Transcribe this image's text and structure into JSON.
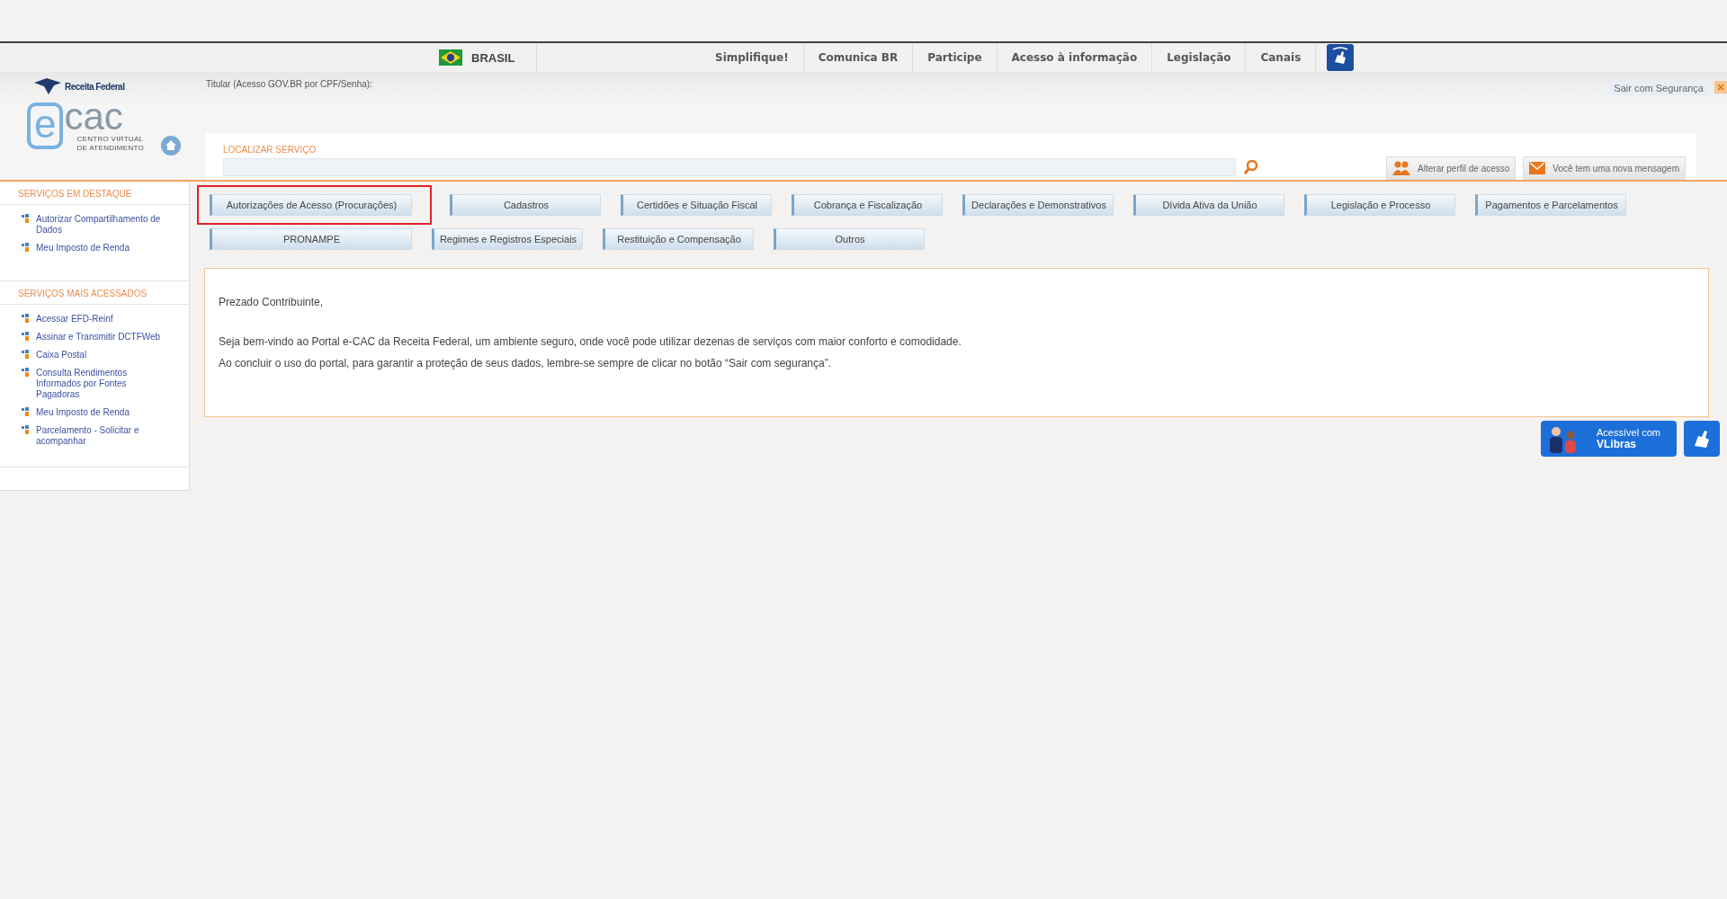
{
  "gov_bar": {
    "country": "BRASIL",
    "links": [
      "Simplifique!",
      "Comunica BR",
      "Participe",
      "Acesso à informação",
      "Legislação",
      "Canais"
    ]
  },
  "header": {
    "agency": "Receita Federal",
    "logo_letter": "e",
    "logo_name": "cac",
    "logo_subtitle": [
      "CENTRO VIRTUAL",
      "DE ATENDIMENTO"
    ],
    "user_label": "Titular (Acesso GOV.BR por CPF/Senha):",
    "logout": "Sair com Segurança"
  },
  "search": {
    "label": "LOCALIZAR SERVIÇO"
  },
  "actions": [
    {
      "kind": "profile",
      "label": "Alterar perfil de acesso"
    },
    {
      "kind": "message",
      "label": "Você tem uma nova mensagem"
    }
  ],
  "sidebar": [
    {
      "title": "SERVIÇOS EM DESTAQUE",
      "items": [
        "Autorizar Compartilhamento de Dados",
        "Meu Imposto de Renda"
      ]
    },
    {
      "title": "SERVIÇOS MAIS ACESSADOS",
      "items": [
        "Acessar EFD-Reinf",
        "Assinar e Transmitir DCTFWeb",
        "Caixa Postal",
        "Consulta Rendimentos Informados por Fontes Pagadoras",
        "Meu Imposto de Renda",
        "Parcelamento - Solicitar e acompanhar"
      ]
    }
  ],
  "categories": [
    [
      {
        "label": "Autorizações de Acesso (Procurações)",
        "highlighted": true
      },
      {
        "label": "Cadastros",
        "highlighted": false
      },
      {
        "label": "Certidões e Situação Fiscal",
        "highlighted": false
      },
      {
        "label": "Cobrança e Fiscalização",
        "highlighted": false
      },
      {
        "label": "Declarações e Demonstrativos",
        "highlighted": false
      },
      {
        "label": "Dívida Ativa da União",
        "highlighted": false
      },
      {
        "label": "Legislação e Processo",
        "highlighted": false
      },
      {
        "label": "Pagamentos e Parcelamentos",
        "highlighted": false
      }
    ],
    [
      {
        "label": "PRONAMPE",
        "highlighted": false
      },
      {
        "label": "Regimes e Registros Especiais",
        "highlighted": false
      },
      {
        "label": "Restituição e Compensação",
        "highlighted": false
      },
      {
        "label": "Outros",
        "highlighted": false
      }
    ]
  ],
  "welcome": {
    "greeting": "Prezado Contribuinte,",
    "paragraphs": [
      "Seja bem-vindo ao Portal e-CAC da Receita Federal, um ambiente seguro, onde você pode utilizar dezenas de serviços com maior conforto e comodidade.",
      "Ao concluir o uso do portal, para garantir a proteção de seus dados, lembre-se sempre de clicar no botão “Sair com segurança”."
    ]
  },
  "vlibras": {
    "line1": "Acessível com",
    "line2": "VLibras"
  }
}
